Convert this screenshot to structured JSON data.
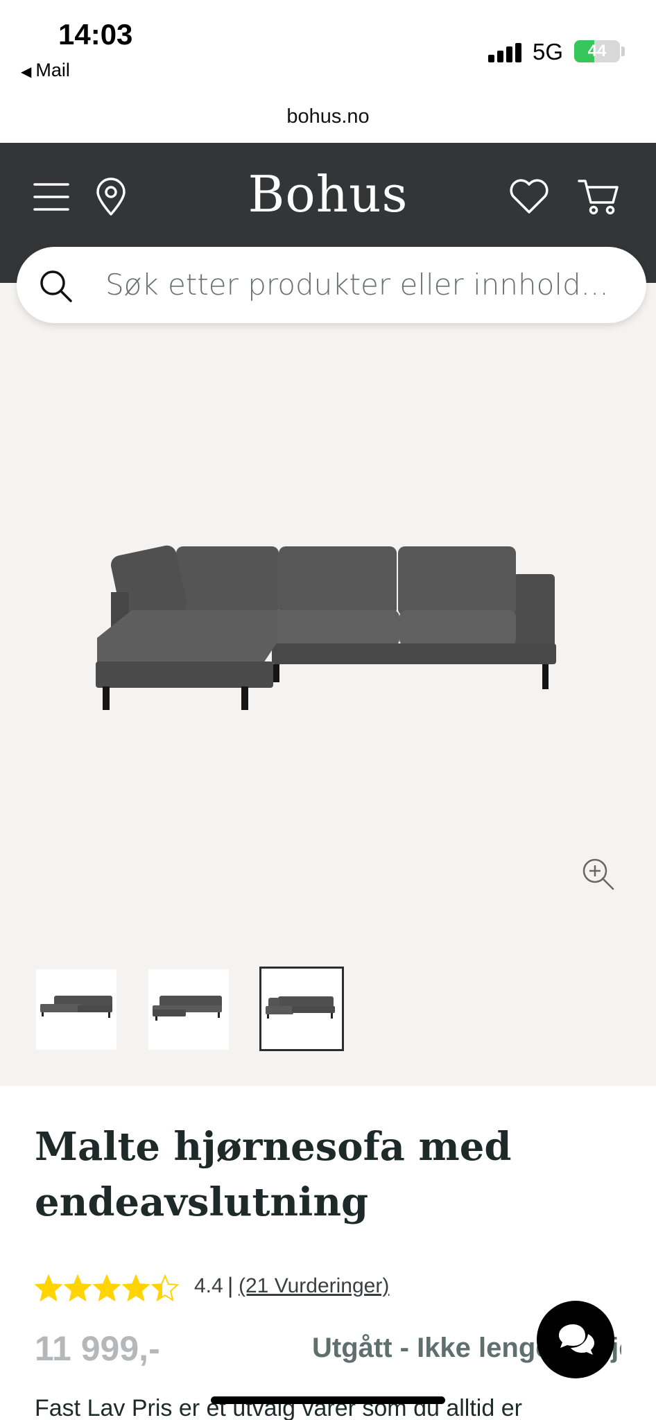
{
  "status_bar": {
    "time": "14:03",
    "back_label": "Mail",
    "network": "5G",
    "battery": "44",
    "battery_level": 0.44
  },
  "browser": {
    "url": "bohus.no"
  },
  "header": {
    "logo": "Bohus",
    "icons": [
      "menu-icon",
      "location-pin-icon",
      "heart-icon",
      "cart-icon"
    ]
  },
  "search": {
    "placeholder": "Søk etter produkter eller innhold..."
  },
  "gallery": {
    "thumbnail_count": 3,
    "active_thumbnail": 3
  },
  "product": {
    "title": "Malte hjørnesofa med endeavslutning",
    "rating": 4.4,
    "rating_text": "4.4",
    "reviews_link": "(21 Vurderinger)",
    "price": "11 999,-",
    "availability": "Utgått - Ikke lenger tilgjengelig",
    "description": "Fast Lav Pris er et utvalg varer som du alltid er"
  },
  "colors": {
    "header_bg": "#343537",
    "gallery_bg": "#f4f3f2",
    "star": "#ffd400",
    "battery": "#35c759"
  }
}
